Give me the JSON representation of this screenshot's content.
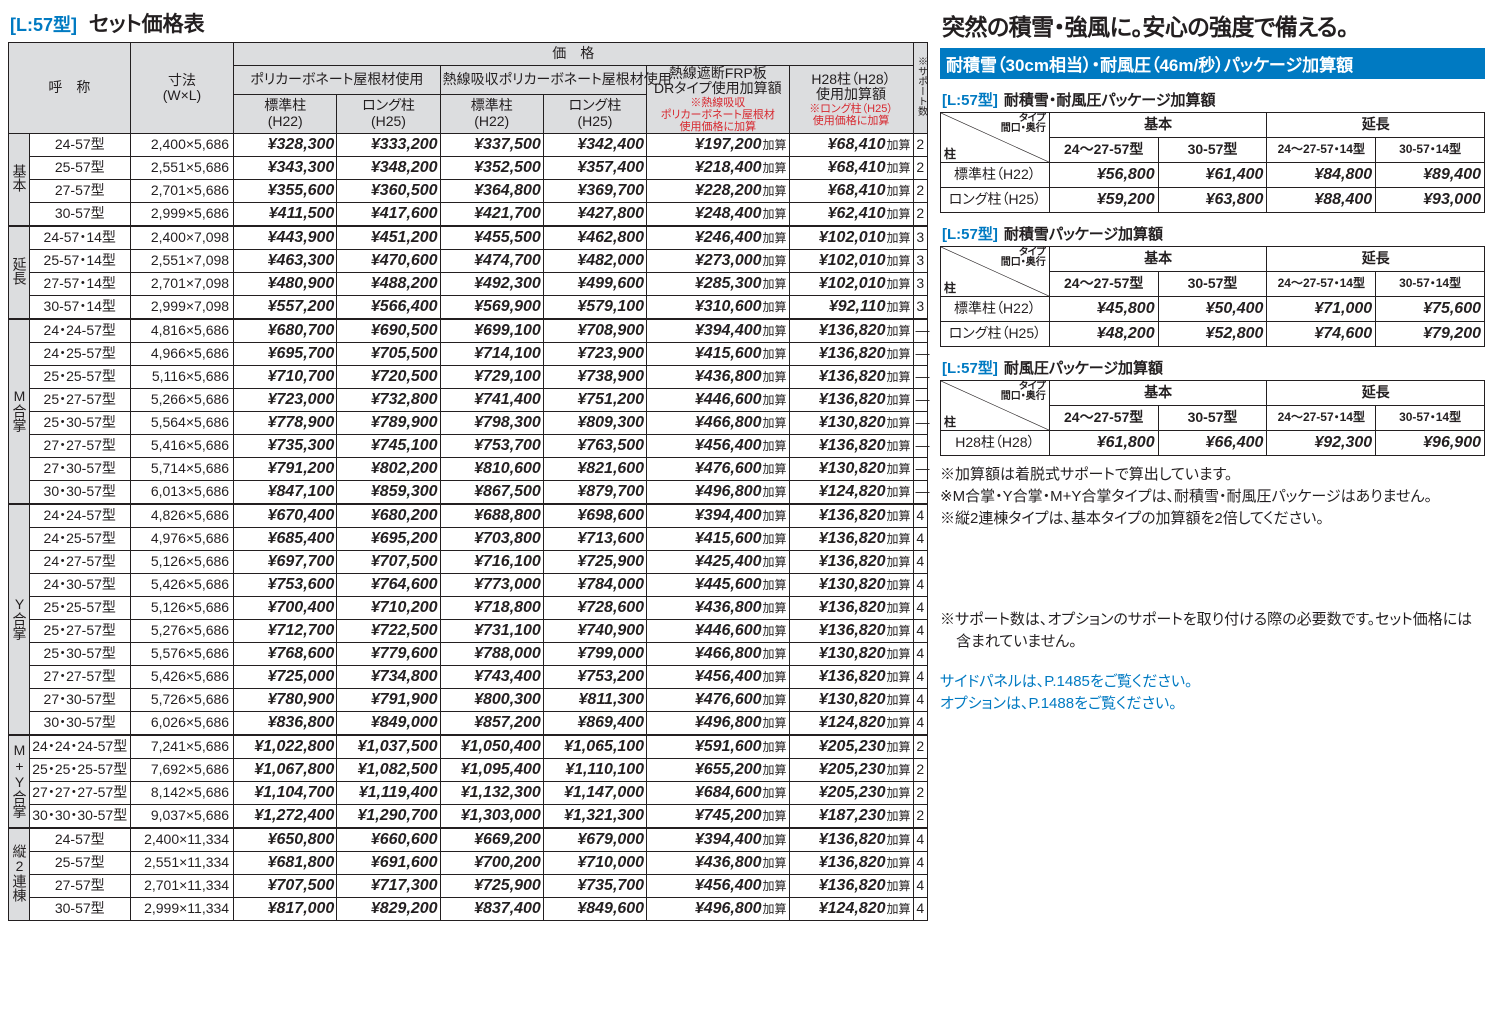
{
  "title_tag": "[L:57型]",
  "title_main": "セット価格表",
  "head": {
    "name": "呼　称",
    "dim": "寸法\n(W×L)",
    "price": "価　格",
    "poly": "ポリカーボネート屋根材使用",
    "heat_poly": "熱線吸収ポリカーボネート屋根材使用",
    "frp": "熱線遮断FRP板\nDRタイプ使用加算額",
    "frp_note": "※熱線吸収\nポリカーボネート屋根材\n使用価格に加算",
    "h28": "H28柱（H28）\n使用加算額",
    "h28_note": "※ロング柱（H25）\n使用価格に加算",
    "std": "標準柱\n(H22)",
    "long": "ロング柱\n(H25)",
    "sup": "※サポート数"
  },
  "cats": [
    "基本",
    "延長",
    "M合掌",
    "Y合掌",
    "M+Y合掌",
    "縦2連棟"
  ],
  "kasan": "加算",
  "rows": [
    {
      "c": 0,
      "n": "24-57型",
      "d": "2,400×5,686",
      "p": [
        "¥328,300",
        "¥333,200",
        "¥337,500",
        "¥342,400"
      ],
      "f": "¥197,200",
      "h": "¥68,410",
      "s": "2"
    },
    {
      "c": 0,
      "n": "25-57型",
      "d": "2,551×5,686",
      "p": [
        "¥343,300",
        "¥348,200",
        "¥352,500",
        "¥357,400"
      ],
      "f": "¥218,400",
      "h": "¥68,410",
      "s": "2"
    },
    {
      "c": 0,
      "n": "27-57型",
      "d": "2,701×5,686",
      "p": [
        "¥355,600",
        "¥360,500",
        "¥364,800",
        "¥369,700"
      ],
      "f": "¥228,200",
      "h": "¥68,410",
      "s": "2"
    },
    {
      "c": 0,
      "n": "30-57型",
      "d": "2,999×5,686",
      "p": [
        "¥411,500",
        "¥417,600",
        "¥421,700",
        "¥427,800"
      ],
      "f": "¥248,400",
      "h": "¥62,410",
      "s": "2"
    },
    {
      "c": 1,
      "n": "24-57・14型",
      "d": "2,400×7,098",
      "p": [
        "¥443,900",
        "¥451,200",
        "¥455,500",
        "¥462,800"
      ],
      "f": "¥246,400",
      "h": "¥102,010",
      "s": "3"
    },
    {
      "c": 1,
      "n": "25-57・14型",
      "d": "2,551×7,098",
      "p": [
        "¥463,300",
        "¥470,600",
        "¥474,700",
        "¥482,000"
      ],
      "f": "¥273,000",
      "h": "¥102,010",
      "s": "3"
    },
    {
      "c": 1,
      "n": "27-57・14型",
      "d": "2,701×7,098",
      "p": [
        "¥480,900",
        "¥488,200",
        "¥492,300",
        "¥499,600"
      ],
      "f": "¥285,300",
      "h": "¥102,010",
      "s": "3"
    },
    {
      "c": 1,
      "n": "30-57・14型",
      "d": "2,999×7,098",
      "p": [
        "¥557,200",
        "¥566,400",
        "¥569,900",
        "¥579,100"
      ],
      "f": "¥310,600",
      "h": "¥92,110",
      "s": "3"
    },
    {
      "c": 2,
      "n": "24・24-57型",
      "d": "4,816×5,686",
      "p": [
        "¥680,700",
        "¥690,500",
        "¥699,100",
        "¥708,900"
      ],
      "f": "¥394,400",
      "h": "¥136,820",
      "s": "—"
    },
    {
      "c": 2,
      "n": "24・25-57型",
      "d": "4,966×5,686",
      "p": [
        "¥695,700",
        "¥705,500",
        "¥714,100",
        "¥723,900"
      ],
      "f": "¥415,600",
      "h": "¥136,820",
      "s": "—"
    },
    {
      "c": 2,
      "n": "25・25-57型",
      "d": "5,116×5,686",
      "p": [
        "¥710,700",
        "¥720,500",
        "¥729,100",
        "¥738,900"
      ],
      "f": "¥436,800",
      "h": "¥136,820",
      "s": "—"
    },
    {
      "c": 2,
      "n": "25・27-57型",
      "d": "5,266×5,686",
      "p": [
        "¥723,000",
        "¥732,800",
        "¥741,400",
        "¥751,200"
      ],
      "f": "¥446,600",
      "h": "¥136,820",
      "s": "—"
    },
    {
      "c": 2,
      "n": "25・30-57型",
      "d": "5,564×5,686",
      "p": [
        "¥778,900",
        "¥789,900",
        "¥798,300",
        "¥809,300"
      ],
      "f": "¥466,800",
      "h": "¥130,820",
      "s": "—"
    },
    {
      "c": 2,
      "n": "27・27-57型",
      "d": "5,416×5,686",
      "p": [
        "¥735,300",
        "¥745,100",
        "¥753,700",
        "¥763,500"
      ],
      "f": "¥456,400",
      "h": "¥136,820",
      "s": "—"
    },
    {
      "c": 2,
      "n": "27・30-57型",
      "d": "5,714×5,686",
      "p": [
        "¥791,200",
        "¥802,200",
        "¥810,600",
        "¥821,600"
      ],
      "f": "¥476,600",
      "h": "¥130,820",
      "s": "—"
    },
    {
      "c": 2,
      "n": "30・30-57型",
      "d": "6,013×5,686",
      "p": [
        "¥847,100",
        "¥859,300",
        "¥867,500",
        "¥879,700"
      ],
      "f": "¥496,800",
      "h": "¥124,820",
      "s": "—"
    },
    {
      "c": 3,
      "n": "24・24-57型",
      "d": "4,826×5,686",
      "p": [
        "¥670,400",
        "¥680,200",
        "¥688,800",
        "¥698,600"
      ],
      "f": "¥394,400",
      "h": "¥136,820",
      "s": "4"
    },
    {
      "c": 3,
      "n": "24・25-57型",
      "d": "4,976×5,686",
      "p": [
        "¥685,400",
        "¥695,200",
        "¥703,800",
        "¥713,600"
      ],
      "f": "¥415,600",
      "h": "¥136,820",
      "s": "4"
    },
    {
      "c": 3,
      "n": "24・27-57型",
      "d": "5,126×5,686",
      "p": [
        "¥697,700",
        "¥707,500",
        "¥716,100",
        "¥725,900"
      ],
      "f": "¥425,400",
      "h": "¥136,820",
      "s": "4"
    },
    {
      "c": 3,
      "n": "24・30-57型",
      "d": "5,426×5,686",
      "p": [
        "¥753,600",
        "¥764,600",
        "¥773,000",
        "¥784,000"
      ],
      "f": "¥445,600",
      "h": "¥130,820",
      "s": "4"
    },
    {
      "c": 3,
      "n": "25・25-57型",
      "d": "5,126×5,686",
      "p": [
        "¥700,400",
        "¥710,200",
        "¥718,800",
        "¥728,600"
      ],
      "f": "¥436,800",
      "h": "¥136,820",
      "s": "4"
    },
    {
      "c": 3,
      "n": "25・27-57型",
      "d": "5,276×5,686",
      "p": [
        "¥712,700",
        "¥722,500",
        "¥731,100",
        "¥740,900"
      ],
      "f": "¥446,600",
      "h": "¥136,820",
      "s": "4"
    },
    {
      "c": 3,
      "n": "25・30-57型",
      "d": "5,576×5,686",
      "p": [
        "¥768,600",
        "¥779,600",
        "¥788,000",
        "¥799,000"
      ],
      "f": "¥466,800",
      "h": "¥130,820",
      "s": "4"
    },
    {
      "c": 3,
      "n": "27・27-57型",
      "d": "5,426×5,686",
      "p": [
        "¥725,000",
        "¥734,800",
        "¥743,400",
        "¥753,200"
      ],
      "f": "¥456,400",
      "h": "¥136,820",
      "s": "4"
    },
    {
      "c": 3,
      "n": "27・30-57型",
      "d": "5,726×5,686",
      "p": [
        "¥780,900",
        "¥791,900",
        "¥800,300",
        "¥811,300"
      ],
      "f": "¥476,600",
      "h": "¥130,820",
      "s": "4"
    },
    {
      "c": 3,
      "n": "30・30-57型",
      "d": "6,026×5,686",
      "p": [
        "¥836,800",
        "¥849,000",
        "¥857,200",
        "¥869,400"
      ],
      "f": "¥496,800",
      "h": "¥124,820",
      "s": "4"
    },
    {
      "c": 4,
      "n": "24・24・24-57型",
      "d": "7,241×5,686",
      "p": [
        "¥1,022,800",
        "¥1,037,500",
        "¥1,050,400",
        "¥1,065,100"
      ],
      "f": "¥591,600",
      "h": "¥205,230",
      "s": "2"
    },
    {
      "c": 4,
      "n": "25・25・25-57型",
      "d": "7,692×5,686",
      "p": [
        "¥1,067,800",
        "¥1,082,500",
        "¥1,095,400",
        "¥1,110,100"
      ],
      "f": "¥655,200",
      "h": "¥205,230",
      "s": "2"
    },
    {
      "c": 4,
      "n": "27・27・27-57型",
      "d": "8,142×5,686",
      "p": [
        "¥1,104,700",
        "¥1,119,400",
        "¥1,132,300",
        "¥1,147,000"
      ],
      "f": "¥684,600",
      "h": "¥205,230",
      "s": "2"
    },
    {
      "c": 4,
      "n": "30・30・30-57型",
      "d": "9,037×5,686",
      "p": [
        "¥1,272,400",
        "¥1,290,700",
        "¥1,303,000",
        "¥1,321,300"
      ],
      "f": "¥745,200",
      "h": "¥187,230",
      "s": "2"
    },
    {
      "c": 5,
      "n": "24-57型",
      "d": "2,400×11,334",
      "p": [
        "¥650,800",
        "¥660,600",
        "¥669,200",
        "¥679,000"
      ],
      "f": "¥394,400",
      "h": "¥136,820",
      "s": "4"
    },
    {
      "c": 5,
      "n": "25-57型",
      "d": "2,551×11,334",
      "p": [
        "¥681,800",
        "¥691,600",
        "¥700,200",
        "¥710,000"
      ],
      "f": "¥436,800",
      "h": "¥136,820",
      "s": "4"
    },
    {
      "c": 5,
      "n": "27-57型",
      "d": "2,701×11,334",
      "p": [
        "¥707,500",
        "¥717,300",
        "¥725,900",
        "¥735,700"
      ],
      "f": "¥456,400",
      "h": "¥136,820",
      "s": "4"
    },
    {
      "c": 5,
      "n": "30-57型",
      "d": "2,999×11,334",
      "p": [
        "¥817,000",
        "¥829,200",
        "¥837,400",
        "¥849,600"
      ],
      "f": "¥496,800",
      "h": "¥124,820",
      "s": "4"
    }
  ],
  "right_head": "突然の積雪・強風に。安心の強度で備える。",
  "pkg_bar": "耐積雪（30cm相当）・耐風圧（46m/秒）パッケージ加算額",
  "side_common": {
    "basic": "基本",
    "ext": "延長",
    "col1": "24～27-57型",
    "col2": "30-57型",
    "col3": "24～27-57・14型",
    "col4": "30-57・14型",
    "diag_t": "タイプ\n間口・奥行",
    "diag_b": "柱"
  },
  "side_tables": [
    {
      "title": "耐積雪・耐風圧パッケージ加算額",
      "rows": [
        {
          "l": "標準柱（H22）",
          "v": [
            "¥56,800",
            "¥61,400",
            "¥84,800",
            "¥89,400"
          ]
        },
        {
          "l": "ロング柱（H25）",
          "v": [
            "¥59,200",
            "¥63,800",
            "¥88,400",
            "¥93,000"
          ]
        }
      ]
    },
    {
      "title": "耐積雪パッケージ加算額",
      "rows": [
        {
          "l": "標準柱（H22）",
          "v": [
            "¥45,800",
            "¥50,400",
            "¥71,000",
            "¥75,600"
          ]
        },
        {
          "l": "ロング柱（H25）",
          "v": [
            "¥48,200",
            "¥52,800",
            "¥74,600",
            "¥79,200"
          ]
        }
      ]
    },
    {
      "title": "耐風圧パッケージ加算額",
      "rows": [
        {
          "l": "H28柱（H28）",
          "v": [
            "¥61,800",
            "¥66,400",
            "¥92,300",
            "¥96,900"
          ]
        }
      ]
    }
  ],
  "notes": [
    "※加算額は着脱式サポートで算出しています。",
    "※M合掌・Y合掌・M+Y合掌タイプは、耐積雪・耐風圧パッケージはありません。",
    "※縦2連棟タイプは、基本タイプの加算額を2倍してください。"
  ],
  "support_note": "※サポート数は、オプションのサポートを取り付ける際の必要数です。セット価格には含まれていません。",
  "links": [
    "サイドパネルは、P.1485をご覧ください。",
    "オプションは、P.1488をご覧ください。"
  ]
}
